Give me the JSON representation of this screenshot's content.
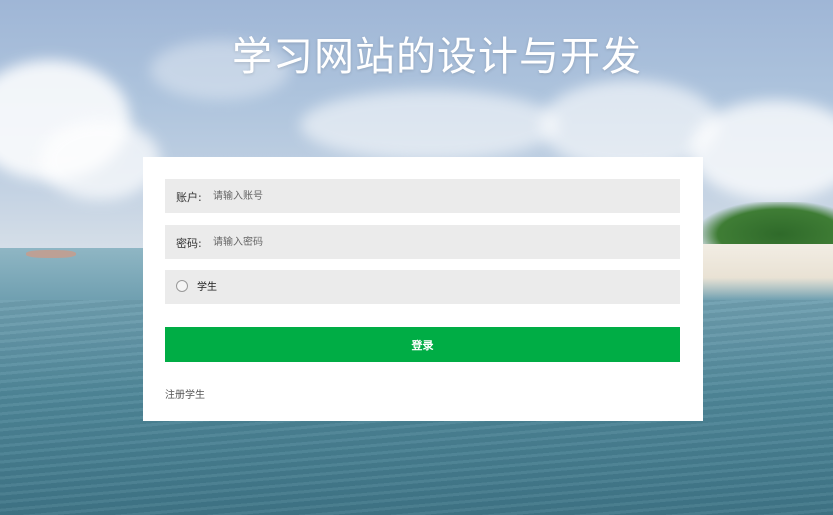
{
  "title": "学习网站的设计与开发",
  "login": {
    "account_label": "账户:",
    "account_placeholder": "请输入账号",
    "password_label": "密码:",
    "password_placeholder": "请输入密码",
    "role_option": "学生",
    "role_selected": false,
    "submit_label": "登录",
    "register_link": "注册学生"
  },
  "colors": {
    "accent": "#00ad45",
    "card": "#ffffff",
    "field_bg": "#ebebeb",
    "title": "#ffffff"
  },
  "background": "seascape-photo"
}
